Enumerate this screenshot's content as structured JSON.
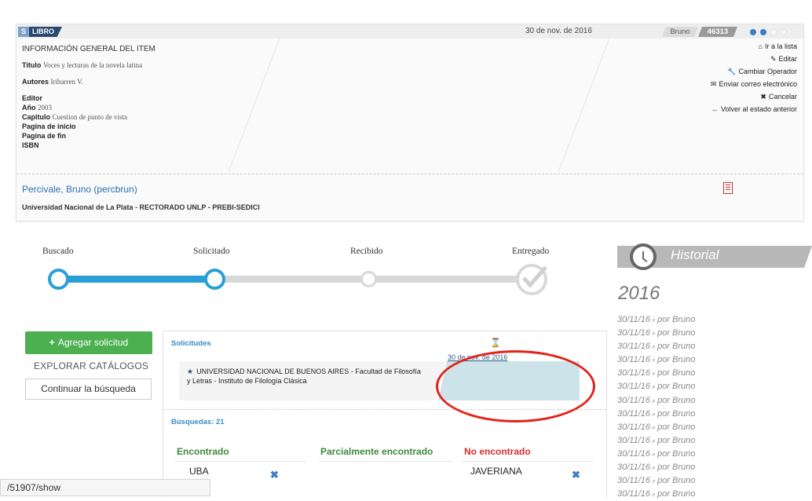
{
  "header": {
    "tag_letter": "S",
    "tag_type": "LIBRO",
    "date": "30 de nov. de 2016",
    "user": "Bruno",
    "number": "46313"
  },
  "item": {
    "section_title": "INFORMACIÓN GENERAL DEL ITEM",
    "titulo_label": "Titulo",
    "titulo_value": "Voces y lecturas de la novela latina",
    "autores_label": "Autores",
    "autores_value": "Iribarren V.",
    "editor_label": "Editor",
    "anio_label": "Año",
    "anio_value": "2003",
    "capitulo_label": "Capitulo",
    "capitulo_value": "Cuestion de punto de vista",
    "pagina_inicio_label": "Pagina de inicio",
    "pagina_fin_label": "Pagina de fin",
    "isbn_label": "ISBN"
  },
  "actions": {
    "ir_lista": "Ir a la lista",
    "editar": "Editar",
    "cambiar_operador": "Cambiar Operador",
    "enviar_correo": "Enviar correo electrónico",
    "cancelar": "Cancelar",
    "volver": "Volver al estado anterior"
  },
  "person": {
    "name": "Percivale, Bruno (percbrun)",
    "institution": "Universidad Nacional de La Plata - RECTORADO UNLP - PREBI-SEDICI"
  },
  "progress": {
    "steps": [
      "Buscado",
      "Solicitado",
      "Recibido",
      "Entregado"
    ],
    "completed_steps": 2
  },
  "history": {
    "title": "Historial",
    "year": "2016",
    "entry_date": "30/11/16",
    "entry_by": "por Bruno",
    "entry_count": 14
  },
  "left_panel": {
    "add_button": "Agregar solicitud",
    "explore": "EXPLORAR CATÁLOGOS",
    "continue_button": "Continuar la búsqueda"
  },
  "solicitudes": {
    "title": "Solicitudes",
    "request_text": "UNIVERSIDAD NACIONAL DE BUENOS AIRES - Facultad de Filosofía y Letras - Instituto de Filología Clásica",
    "request_date": "30 de nov. de 2016",
    "busquedas": "Búsquedas: 21",
    "col_encontrado": "Encontrado",
    "col_parcial": "Parcialmente encontrado",
    "col_no": "No encontrado",
    "encontrado_first": "UBA",
    "no_encontrado_first": "JAVERIANA"
  },
  "statusbar": {
    "url": "/51907/show"
  },
  "colors": {
    "accent_blue": "#2a9fd6",
    "green": "#4caf50",
    "link_blue": "#2f6fb0",
    "annotation_red": "#e2231a"
  }
}
